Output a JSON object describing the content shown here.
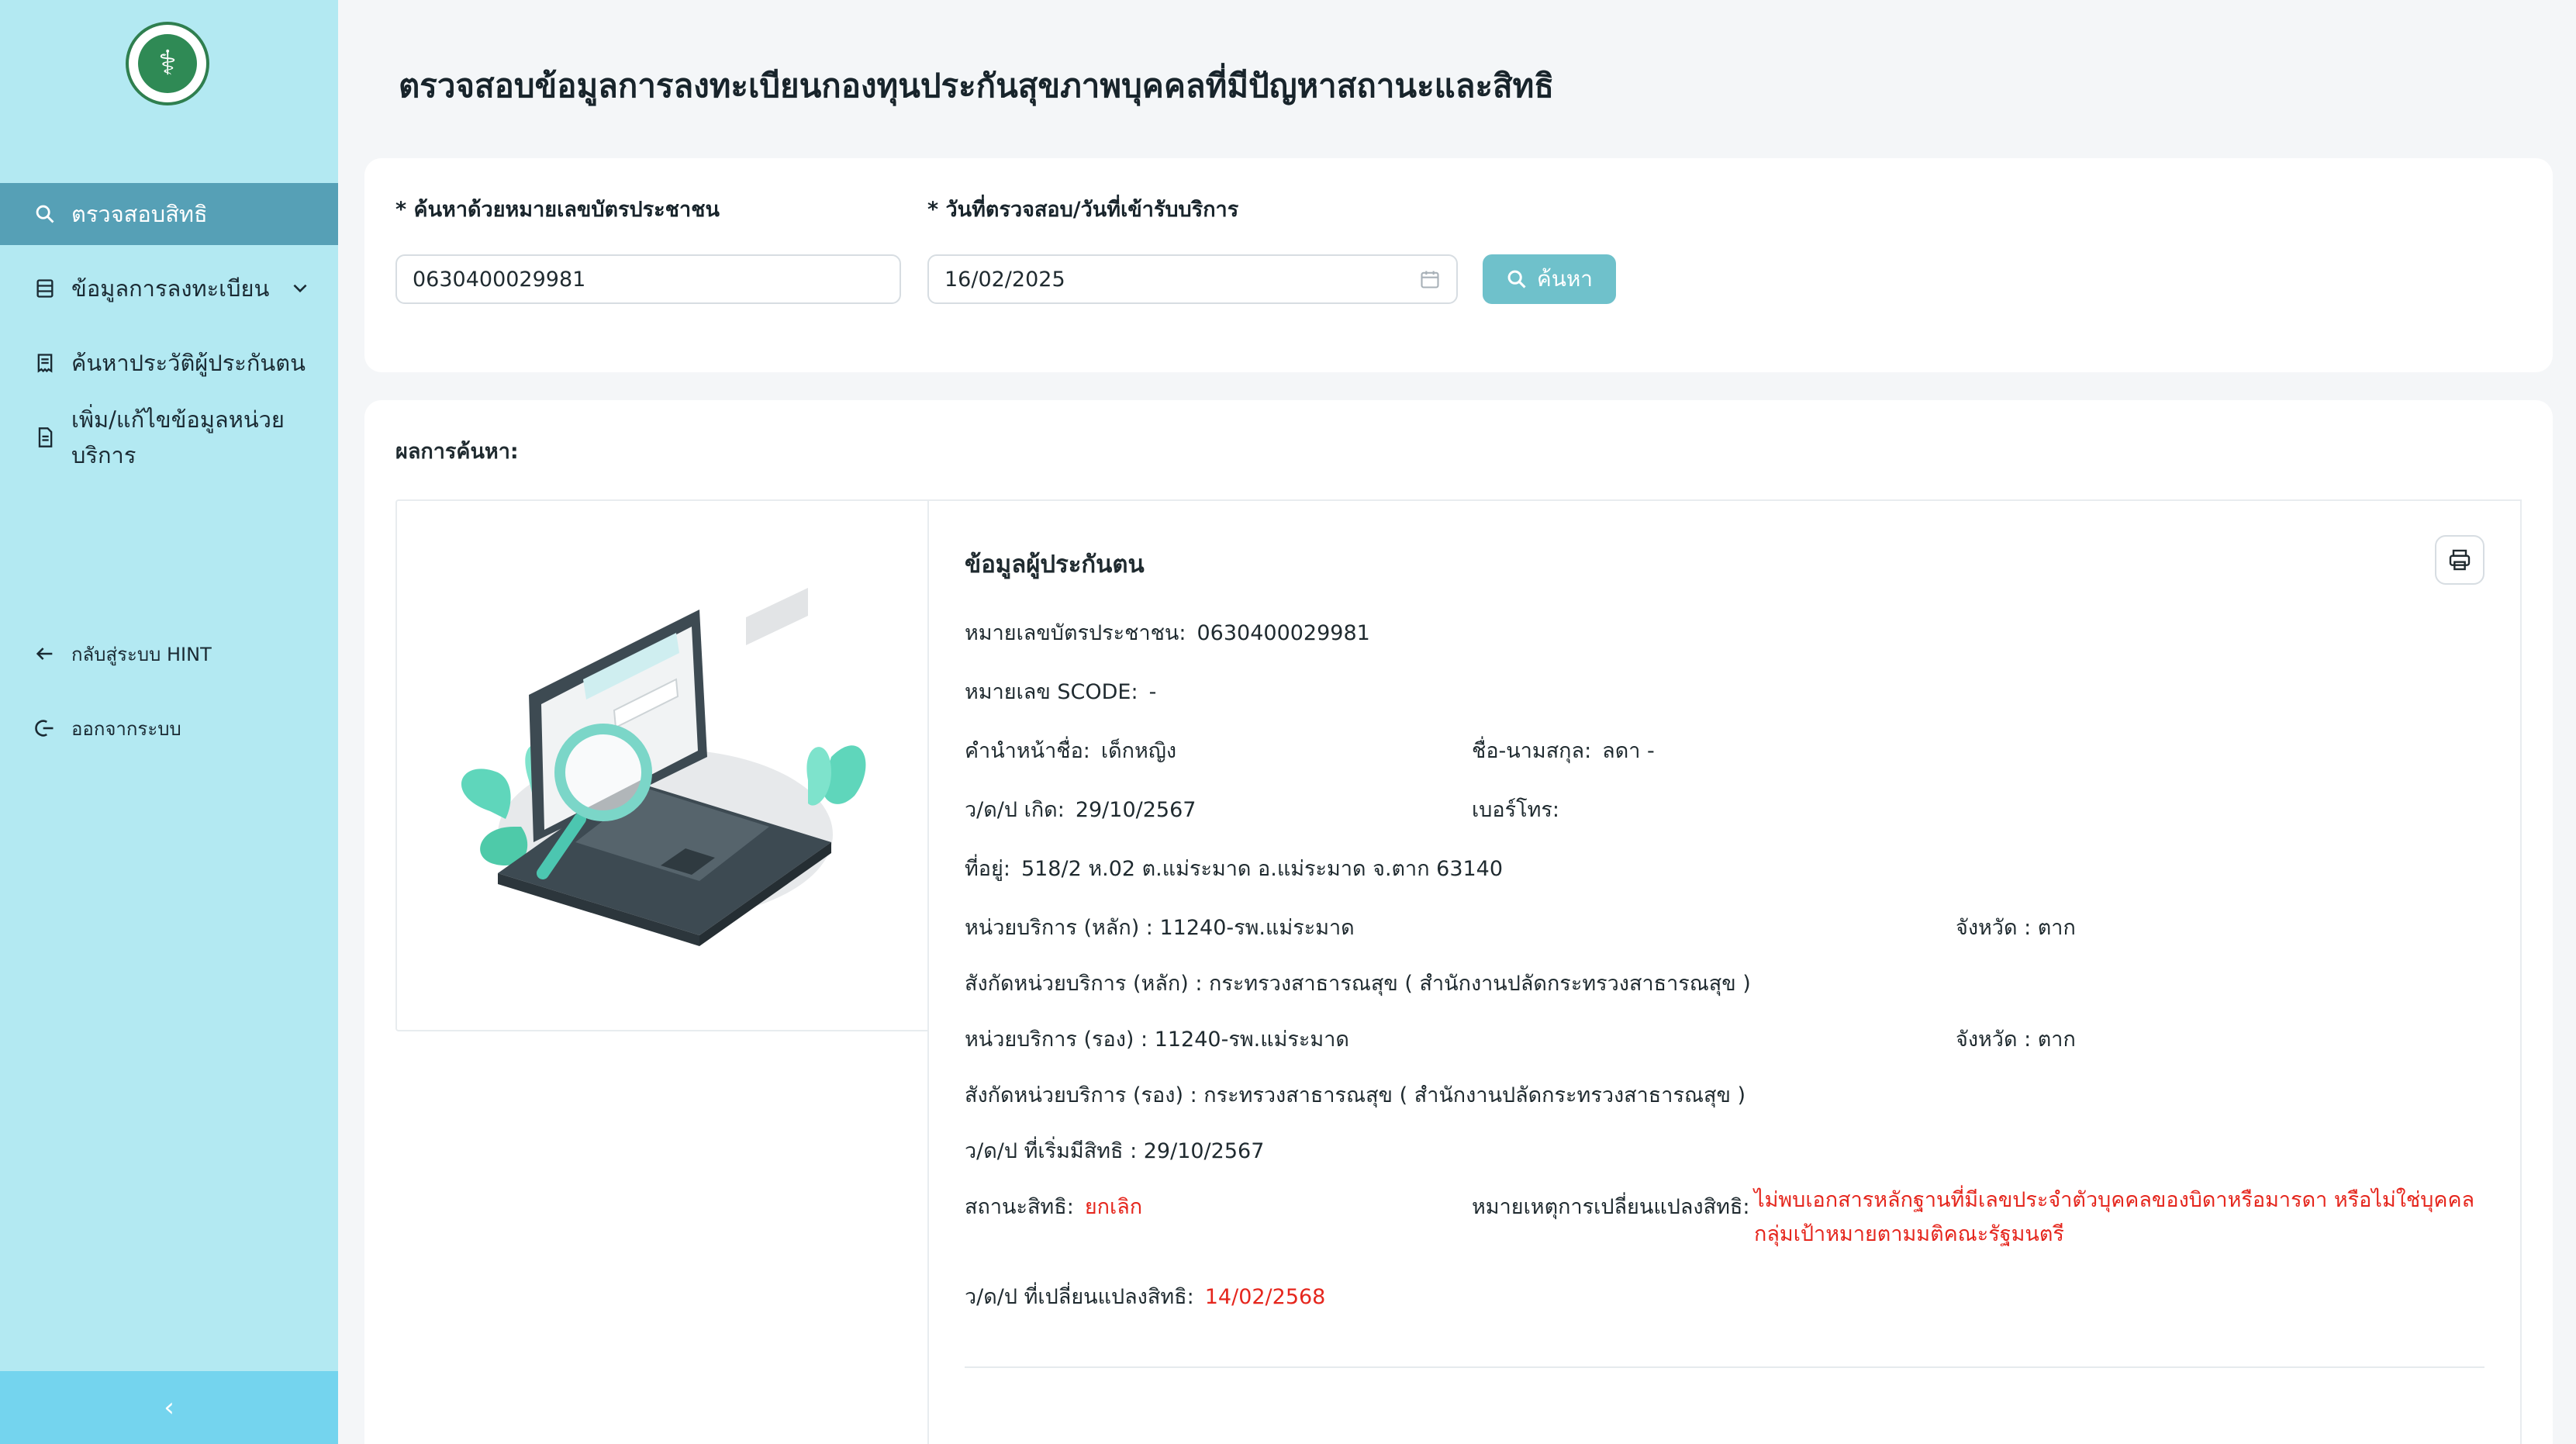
{
  "sidebar": {
    "logo_icon": "ministry-seal-icon",
    "items": [
      {
        "label": "ตรวจสอบสิทธิ",
        "icon": "search-icon",
        "active": true
      },
      {
        "label": "ข้อมูลการลงทะเบียน",
        "icon": "list-icon",
        "has_submenu": true
      },
      {
        "label": "ค้นหาประวัติผู้ประกันตน",
        "icon": "receipt-icon"
      },
      {
        "label": "เพิ่ม/แก้ไขข้อมูลหน่วยบริการ",
        "icon": "document-icon"
      }
    ],
    "bottom_items": [
      {
        "label": "กลับสู่ระบบ HINT",
        "icon": "arrow-left-icon"
      },
      {
        "label": "ออกจากระบบ",
        "icon": "logout-icon"
      }
    ],
    "collapse_icon": "chevron-left-icon",
    "colors": {
      "background": "#b3e9f2",
      "active": "#56a0b6",
      "collapse_bar": "#74d4ee"
    }
  },
  "page": {
    "title": "ตรวจสอบข้อมูลการลงทะเบียนกองทุนประกันสุขภาพบุคคลที่มีปัญหาสถานะและสิทธิ"
  },
  "search": {
    "id_label": "* ค้นหาด้วยหมายเลขบัตรประชาชน",
    "id_value": "0630400029981",
    "date_label": "* วันที่ตรวจสอบ/วันที่เข้ารับบริการ",
    "date_value": "16/02/2025",
    "button_label": "ค้นหา",
    "button_color": "#6fc1cb"
  },
  "result": {
    "label": "ผลการค้นหา:",
    "section_title": "ข้อมูลผู้ประกันตน",
    "id_label": "หมายเลขบัตรประชาชน:",
    "id_value": "0630400029981",
    "scode_label": "หมายเลข SCODE:",
    "scode_value": "-",
    "prefix_label": "คำนำหน้าชื่อ:",
    "prefix_value": "เด็กหญิง",
    "name_label": "ชื่อ-นามสกุล:",
    "name_value": "ลดา -",
    "dob_label": "ว/ด/ป เกิด:",
    "dob_value": "29/10/2567",
    "phone_label": "เบอร์โทร:",
    "phone_value": "",
    "address_label": "ที่อยู่:",
    "address_value": "518/2 ห.02 ต.แม่ระมาด อ.แม่ระมาด จ.ตาก 63140",
    "main_unit": "หน่วยบริการ (หลัก) : 11240-รพ.แม่ระมาด",
    "main_province": "จังหวัด : ตาก",
    "main_affiliation": "สังกัดหน่วยบริการ (หลัก) : กระทรวงสาธารณสุข ( สำนักงานปลัดกระทรวงสาธารณสุข )",
    "sub_unit": "หน่วยบริการ (รอง) : 11240-รพ.แม่ระมาด",
    "sub_province": "จังหวัด : ตาก",
    "sub_affiliation": "สังกัดหน่วยบริการ (รอง) : กระทรวงสาธารณสุข ( สำนักงานปลัดกระทรวงสาธารณสุข )",
    "start_date": "ว/ด/ป ที่เริ่มมีสิทธิ : 29/10/2567",
    "status_label": "สถานะสิทธิ:",
    "status_value": "ยกเลิก",
    "reason_label": "หมายเหตุการเปลี่ยนแปลงสิทธิ:",
    "reason_value": "ไม่พบเอกสารหลักฐานที่มีเลขประจำตัวบุคคลของบิดาหรือมารดา หรือไม่ใช่บุคคลกลุ่มเป้าหมายตามมติคณะรัฐมนตรี",
    "change_date_label": "ว/ด/ป ที่เปลี่ยนแปลงสิทธิ:",
    "change_date_value": "14/02/2568",
    "status_color": "#e5261d"
  }
}
